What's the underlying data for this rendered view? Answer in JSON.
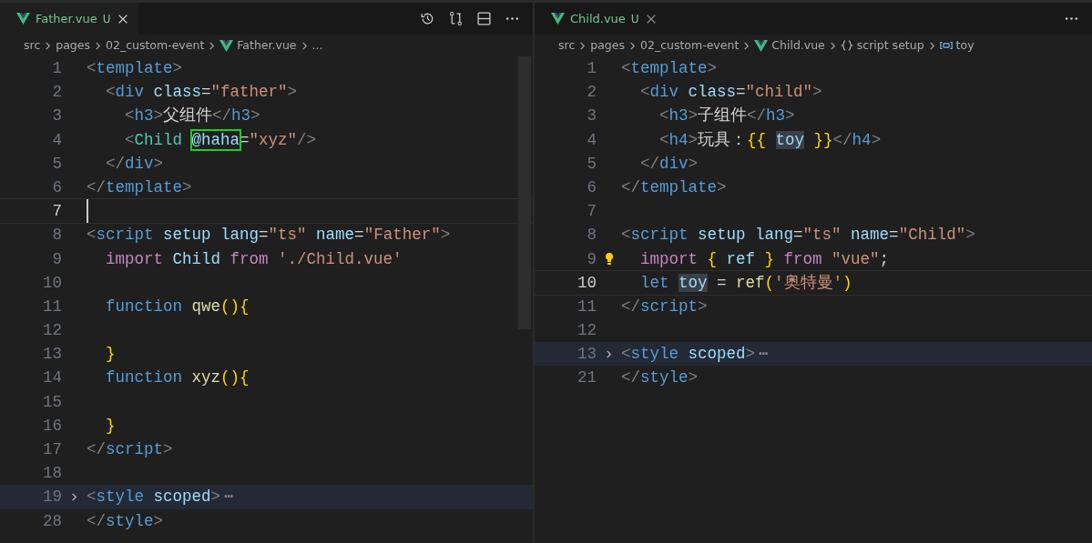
{
  "editors": [
    {
      "tab": {
        "label": "Father.vue",
        "badge": "U",
        "selected": true
      },
      "breadcrumbs": [
        {
          "text": "src"
        },
        {
          "text": "pages"
        },
        {
          "text": "02_custom-event"
        },
        {
          "text": "Father.vue",
          "kind": "vue"
        },
        {
          "text": "..."
        }
      ],
      "lines": [
        {
          "number": "1",
          "tokens": [
            {
              "t": "<",
              "kind": "punct"
            },
            {
              "t": "template",
              "kind": "tag"
            },
            {
              "t": ">",
              "kind": "punct"
            }
          ]
        },
        {
          "number": "2",
          "tokens": [
            {
              "t": "  <",
              "kind": "punct"
            },
            {
              "t": "div",
              "kind": "tag"
            },
            {
              "t": " class",
              "kind": "attr"
            },
            {
              "t": "=",
              "kind": "text"
            },
            {
              "t": "\"father\"",
              "kind": "str"
            },
            {
              "t": ">",
              "kind": "punct"
            }
          ]
        },
        {
          "number": "3",
          "tokens": [
            {
              "t": "    <",
              "kind": "punct"
            },
            {
              "t": "h3",
              "kind": "tag"
            },
            {
              "t": ">",
              "kind": "punct"
            },
            {
              "t": "父组件",
              "kind": "text"
            },
            {
              "t": "</",
              "kind": "punct"
            },
            {
              "t": "h3",
              "kind": "tag"
            },
            {
              "t": ">",
              "kind": "punct"
            }
          ]
        },
        {
          "number": "4",
          "tokens": [
            {
              "t": "    <",
              "kind": "punct"
            },
            {
              "t": "Child ",
              "kind": "type"
            },
            {
              "t": "@haha",
              "kind": "attr",
              "outlined": true
            },
            {
              "t": "=",
              "kind": "text"
            },
            {
              "t": "\"xyz\"",
              "kind": "str"
            },
            {
              "t": "/>",
              "kind": "punct"
            }
          ]
        },
        {
          "number": "5",
          "tokens": [
            {
              "t": "  </",
              "kind": "punct"
            },
            {
              "t": "div",
              "kind": "tag"
            },
            {
              "t": ">",
              "kind": "punct"
            }
          ]
        },
        {
          "number": "6",
          "tokens": [
            {
              "t": "</",
              "kind": "punct"
            },
            {
              "t": "template",
              "kind": "tag"
            },
            {
              "t": ">",
              "kind": "punct"
            }
          ]
        },
        {
          "number": "7",
          "current": true
        },
        {
          "number": "8",
          "tokens": [
            {
              "t": "<",
              "kind": "punct"
            },
            {
              "t": "script",
              "kind": "tag"
            },
            {
              "t": " setup lang",
              "kind": "attr"
            },
            {
              "t": "=",
              "kind": "text"
            },
            {
              "t": "\"ts\"",
              "kind": "str"
            },
            {
              "t": " name",
              "kind": "attr"
            },
            {
              "t": "=",
              "kind": "text"
            },
            {
              "t": "\"Father\"",
              "kind": "str"
            },
            {
              "t": ">",
              "kind": "punct"
            }
          ]
        },
        {
          "number": "9",
          "tokens": [
            {
              "t": "  import",
              "kind": "kw"
            },
            {
              "t": " Child ",
              "kind": "attr"
            },
            {
              "t": "from",
              "kind": "kw"
            },
            {
              "t": " './Child.vue'",
              "kind": "str"
            }
          ]
        },
        {
          "number": "10"
        },
        {
          "number": "11",
          "tokens": [
            {
              "t": "  function",
              "kind": "tag"
            },
            {
              "t": " qwe",
              "kind": "func"
            },
            {
              "t": "(){",
              "kind": "brace"
            }
          ]
        },
        {
          "number": "12"
        },
        {
          "number": "13",
          "tokens": [
            {
              "t": "  }",
              "kind": "brace"
            }
          ]
        },
        {
          "number": "14",
          "tokens": [
            {
              "t": "  function",
              "kind": "tag"
            },
            {
              "t": " xyz",
              "kind": "func"
            },
            {
              "t": "(){",
              "kind": "brace"
            }
          ]
        },
        {
          "number": "15"
        },
        {
          "number": "16",
          "tokens": [
            {
              "t": "  }",
              "kind": "brace"
            }
          ]
        },
        {
          "number": "17",
          "tokens": [
            {
              "t": "</",
              "kind": "punct"
            },
            {
              "t": "script",
              "kind": "tag"
            },
            {
              "t": ">",
              "kind": "punct"
            }
          ]
        },
        {
          "number": "18"
        },
        {
          "number": "19",
          "folded": true,
          "fold_mark": "⋯",
          "tokens": [
            {
              "t": "<",
              "kind": "punct"
            },
            {
              "t": "style",
              "kind": "tag"
            },
            {
              "t": " scoped",
              "kind": "attr"
            },
            {
              "t": ">",
              "kind": "punct"
            }
          ]
        },
        {
          "number": "28",
          "tokens": [
            {
              "t": "</",
              "kind": "punct"
            },
            {
              "t": "style",
              "kind": "tag"
            },
            {
              "t": ">",
              "kind": "punct"
            }
          ]
        }
      ]
    },
    {
      "tab": {
        "label": "Child.vue",
        "badge": "U",
        "selected": false
      },
      "breadcrumbs": [
        {
          "text": "src"
        },
        {
          "text": "pages"
        },
        {
          "text": "02_custom-event"
        },
        {
          "text": "Child.vue",
          "kind": "vue"
        },
        {
          "text": "script setup",
          "kind": "braces"
        },
        {
          "text": "toy",
          "kind": "symbol"
        }
      ],
      "lines": [
        {
          "number": "1",
          "tokens": [
            {
              "t": "<",
              "kind": "punct"
            },
            {
              "t": "template",
              "kind": "tag"
            },
            {
              "t": ">",
              "kind": "punct"
            }
          ]
        },
        {
          "number": "2",
          "tokens": [
            {
              "t": "  <",
              "kind": "punct"
            },
            {
              "t": "div",
              "kind": "tag"
            },
            {
              "t": " class",
              "kind": "attr"
            },
            {
              "t": "=",
              "kind": "text"
            },
            {
              "t": "\"child\"",
              "kind": "str"
            },
            {
              "t": ">",
              "kind": "punct"
            }
          ]
        },
        {
          "number": "3",
          "tokens": [
            {
              "t": "    <",
              "kind": "punct"
            },
            {
              "t": "h3",
              "kind": "tag"
            },
            {
              "t": ">",
              "kind": "punct"
            },
            {
              "t": "子组件",
              "kind": "text"
            },
            {
              "t": "</",
              "kind": "punct"
            },
            {
              "t": "h3",
              "kind": "tag"
            },
            {
              "t": ">",
              "kind": "punct"
            }
          ]
        },
        {
          "number": "4",
          "tokens": [
            {
              "t": "    <",
              "kind": "punct"
            },
            {
              "t": "h4",
              "kind": "tag"
            },
            {
              "t": ">",
              "kind": "punct"
            },
            {
              "t": "玩具：",
              "kind": "text"
            },
            {
              "t": "{{ ",
              "kind": "brace"
            },
            {
              "t": "toy",
              "kind": "attr",
              "highlighted": true
            },
            {
              "t": " }}",
              "kind": "brace"
            },
            {
              "t": "</",
              "kind": "punct"
            },
            {
              "t": "h4",
              "kind": "tag"
            },
            {
              "t": ">",
              "kind": "punct"
            }
          ]
        },
        {
          "number": "5",
          "tokens": [
            {
              "t": "  </",
              "kind": "punct"
            },
            {
              "t": "div",
              "kind": "tag"
            },
            {
              "t": ">",
              "kind": "punct"
            }
          ]
        },
        {
          "number": "6",
          "tokens": [
            {
              "t": "</",
              "kind": "punct"
            },
            {
              "t": "template",
              "kind": "tag"
            },
            {
              "t": ">",
              "kind": "punct"
            }
          ]
        },
        {
          "number": "7"
        },
        {
          "number": "8",
          "tokens": [
            {
              "t": "<",
              "kind": "punct"
            },
            {
              "t": "script",
              "kind": "tag"
            },
            {
              "t": " setup lang",
              "kind": "attr"
            },
            {
              "t": "=",
              "kind": "text"
            },
            {
              "t": "\"ts\"",
              "kind": "str"
            },
            {
              "t": " name",
              "kind": "attr"
            },
            {
              "t": "=",
              "kind": "text"
            },
            {
              "t": "\"Child\"",
              "kind": "str"
            },
            {
              "t": ">",
              "kind": "punct"
            }
          ]
        },
        {
          "number": "9",
          "lightbulb": true,
          "tokens": [
            {
              "t": "  import",
              "kind": "kw"
            },
            {
              "t": " { ",
              "kind": "brace"
            },
            {
              "t": "ref",
              "kind": "attr"
            },
            {
              "t": " } ",
              "kind": "brace"
            },
            {
              "t": "from",
              "kind": "kw"
            },
            {
              "t": " \"vue\"",
              "kind": "str"
            },
            {
              "t": ";",
              "kind": "text"
            }
          ]
        },
        {
          "number": "10",
          "current": true,
          "tokens": [
            {
              "t": "  let ",
              "kind": "tag"
            },
            {
              "t": "toy",
              "kind": "attr",
              "highlighted": true
            },
            {
              "t": " = ",
              "kind": "text"
            },
            {
              "t": "ref",
              "kind": "func"
            },
            {
              "t": "(",
              "kind": "brace"
            },
            {
              "t": "'奥特曼'",
              "kind": "str"
            },
            {
              "t": ")",
              "kind": "brace"
            }
          ]
        },
        {
          "number": "11",
          "tokens": [
            {
              "t": "</",
              "kind": "punct"
            },
            {
              "t": "script",
              "kind": "tag"
            },
            {
              "t": ">",
              "kind": "punct"
            }
          ]
        },
        {
          "number": "12"
        },
        {
          "number": "13",
          "folded": true,
          "fold_mark": "⋯",
          "tokens": [
            {
              "t": "<",
              "kind": "punct"
            },
            {
              "t": "style",
              "kind": "tag"
            },
            {
              "t": " scoped",
              "kind": "attr"
            },
            {
              "t": ">",
              "kind": "punct"
            }
          ]
        },
        {
          "number": "21",
          "tokens": [
            {
              "t": "</",
              "kind": "punct"
            },
            {
              "t": "style",
              "kind": "tag"
            },
            {
              "t": ">",
              "kind": "punct"
            }
          ]
        }
      ]
    }
  ]
}
